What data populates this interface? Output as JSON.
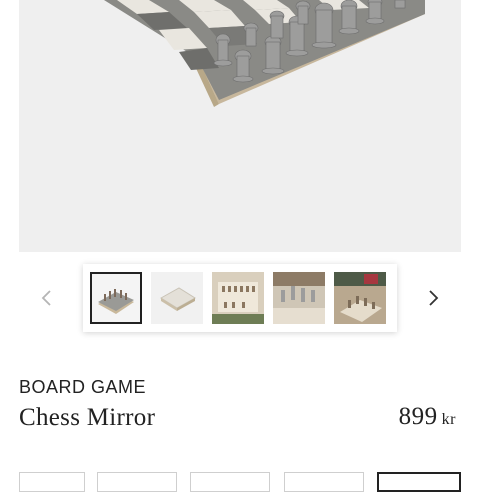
{
  "product": {
    "category": "BOARD GAME",
    "title": "Chess Mirror",
    "price_amount": "899",
    "price_currency": "kr"
  },
  "gallery": {
    "selected_index": 0,
    "thumbnails": [
      {
        "name": "thumbnail-board-angled"
      },
      {
        "name": "thumbnail-board-closed"
      },
      {
        "name": "thumbnail-board-top"
      },
      {
        "name": "thumbnail-board-pieces"
      },
      {
        "name": "thumbnail-board-lifestyle"
      }
    ],
    "prev_icon": "chevron-left-icon",
    "next_icon": "chevron-right-icon"
  },
  "colors": {
    "text": "#222222",
    "hero_bg": "#efefef",
    "nav_prev": "#b5b5b5",
    "nav_next": "#333333"
  }
}
